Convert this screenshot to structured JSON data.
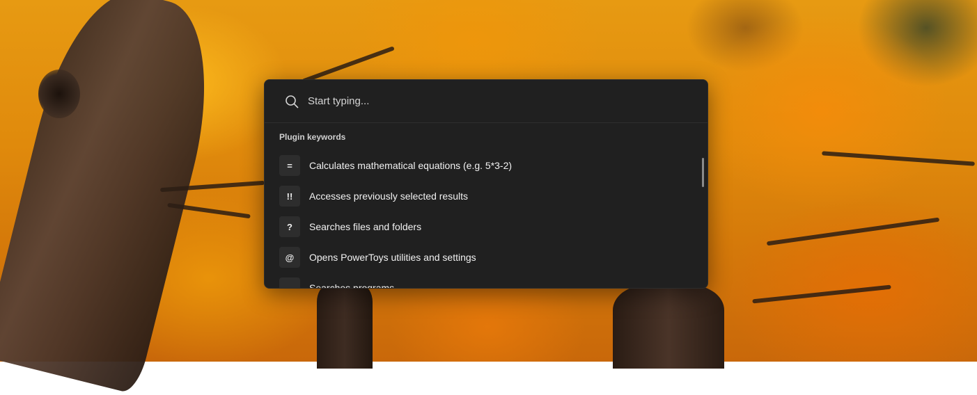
{
  "search": {
    "placeholder": "Start typing...",
    "value": ""
  },
  "section": {
    "title": "Plugin keywords"
  },
  "results": [
    {
      "keyword": "=",
      "description": "Calculates mathematical equations (e.g. 5*3-2)"
    },
    {
      "keyword": "!!",
      "description": "Accesses previously selected results"
    },
    {
      "keyword": "?",
      "description": "Searches files and folders"
    },
    {
      "keyword": "@",
      "description": "Opens PowerToys utilities and settings"
    },
    {
      "keyword": ".",
      "description": "Searches programs"
    }
  ],
  "icons": {
    "search": "search-icon"
  },
  "colors": {
    "window_background": "#202020",
    "badge_background": "#2d2d2d",
    "text": "#f2f2f2"
  }
}
